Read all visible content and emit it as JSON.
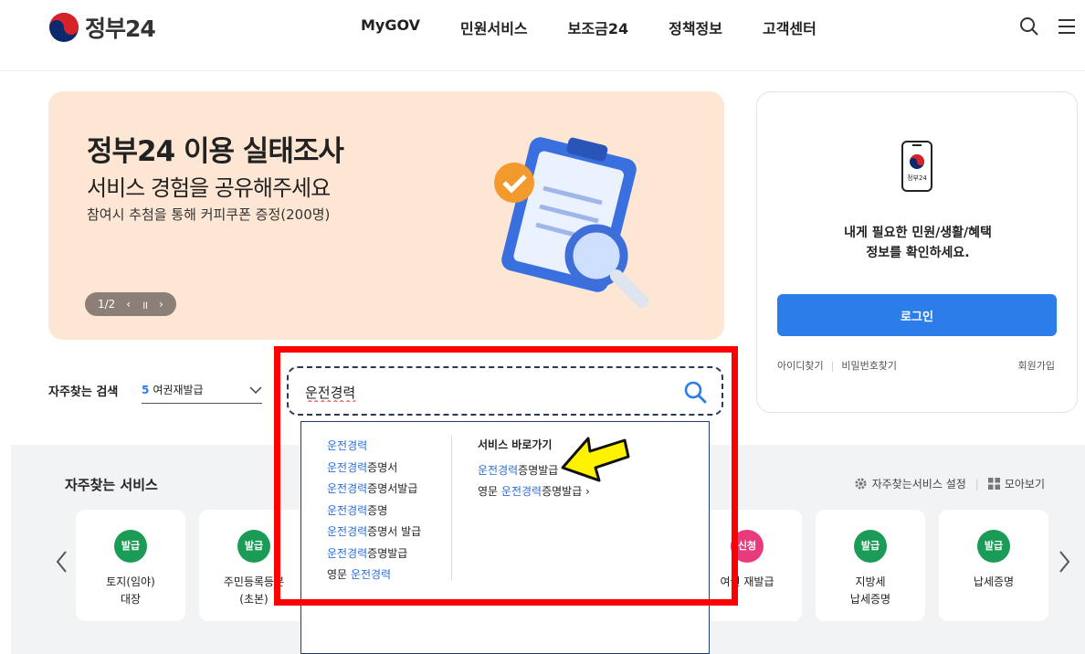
{
  "header": {
    "logo_text": "정부24",
    "nav": [
      "MyGOV",
      "민원서비스",
      "보조금24",
      "정책정보",
      "고객센터"
    ]
  },
  "banner": {
    "title": "정부24 이용 실태조사",
    "subtitle": "서비스 경험을 공유해주세요",
    "description": "참여시 추첨을 통해 커피쿠폰 증정(200명)",
    "pager": "1/2"
  },
  "login": {
    "phone_label": "정부24",
    "message_line1": "내게 필요한 민원/생활/혜택",
    "message_line2": "정보를 확인하세요.",
    "button": "로그인",
    "find_id": "아이디찾기",
    "find_pw": "비밀번호찾기",
    "join": "회원가입"
  },
  "popular": {
    "label": "자주찾는 검색",
    "rank": "5",
    "keyword": "여권재발급"
  },
  "search": {
    "value": "운전경력"
  },
  "autocomplete": {
    "items": [
      {
        "hl_pre": "",
        "hl": "운전경력",
        "rest": ""
      },
      {
        "hl_pre": "",
        "hl": "운전경력",
        "rest": "증명서"
      },
      {
        "hl_pre": "",
        "hl": "운전경력",
        "rest": "증명서발급"
      },
      {
        "hl_pre": "",
        "hl": "운전경력",
        "rest": "증명"
      },
      {
        "hl_pre": "",
        "hl": "운전경력",
        "rest": "증명서 발급"
      },
      {
        "hl_pre": "",
        "hl": "운전경력",
        "rest": "증명발급"
      },
      {
        "hl_pre": "영문 ",
        "hl": "운전경력",
        "rest": ""
      }
    ],
    "shortcut_title": "서비스 바로가기",
    "shortcuts": [
      {
        "pre": "",
        "hl": "운전경력",
        "rest": "증명발급"
      },
      {
        "pre": "영문 ",
        "hl": "운전경력",
        "rest": "증명발급 ›"
      }
    ]
  },
  "services": {
    "title": "자주찾는 서비스",
    "settings": "자주찾는서비스 설정",
    "view_all": "모아보기",
    "cards": [
      {
        "badge": "발급",
        "line1": "토지(임야)",
        "line2": "대장",
        "color": "#1a9c56"
      },
      {
        "badge": "발급",
        "line1": "주민등록등본",
        "line2": "(초본)",
        "color": "#1a9c56"
      },
      {
        "badge": "신청",
        "line1": "여권 재발급",
        "line2": "",
        "color": "#e83a7c"
      },
      {
        "badge": "발급",
        "line1": "지방세",
        "line2": "납세증명",
        "color": "#1a9c56"
      },
      {
        "badge": "발급",
        "line1": "납세증명",
        "line2": "",
        "color": "#1a9c56"
      }
    ]
  }
}
